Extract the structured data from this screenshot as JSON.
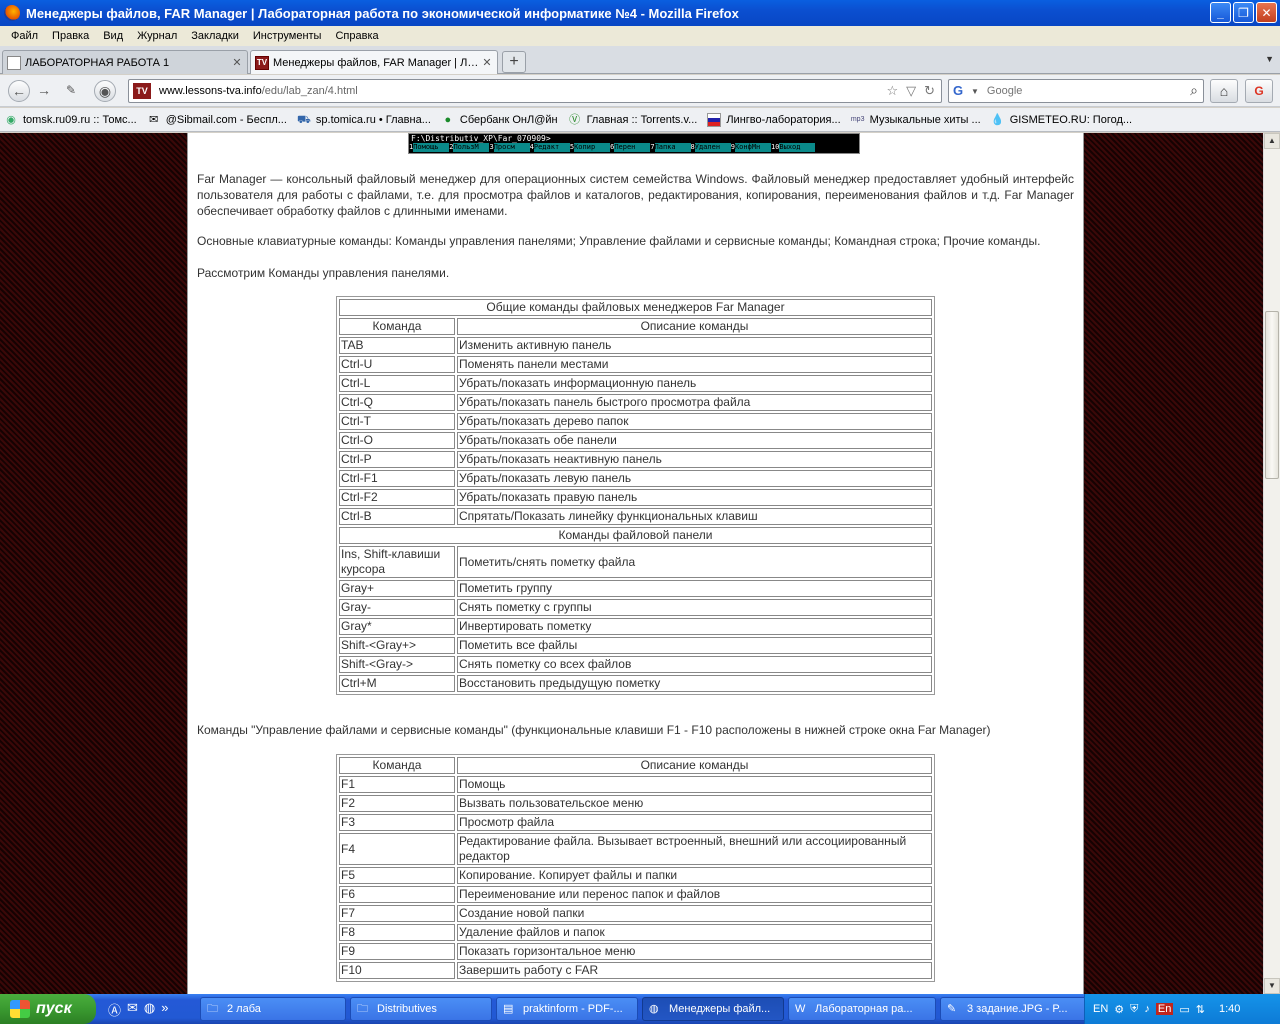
{
  "window": {
    "title": "Менеджеры файлов, FAR Manager | Лабораторная работа по экономической информатике №4 - Mozilla Firefox"
  },
  "menu": [
    "Файл",
    "Правка",
    "Вид",
    "Журнал",
    "Закладки",
    "Инструменты",
    "Справка"
  ],
  "tabs": [
    {
      "label": "ЛАБОРАТОРНАЯ РАБОТА 1"
    },
    {
      "label": "Менеджеры файлов, FAR Manager | Ла..."
    }
  ],
  "nav": {
    "url_host": "www.lessons-tva.info",
    "url_path": "/edu/lab_zan/4.html",
    "search_placeholder": "Google",
    "site_icon": "TV"
  },
  "bookmarks": [
    {
      "label": "tomsk.ru09.ru :: Томс...",
      "icon": "globe-icon"
    },
    {
      "label": "@Sibmail.com - Беспл...",
      "icon": "mail-icon"
    },
    {
      "label": "sp.tomica.ru • Главна...",
      "icon": "cart-icon"
    },
    {
      "label": "Сбербанк ОнЛ@йн",
      "icon": "sberbank-icon"
    },
    {
      "label": "Главная :: Torrents.v...",
      "icon": "torrent-icon"
    },
    {
      "label": "Лингво-лаборатория...",
      "icon": "flag-icon"
    },
    {
      "label": "Музыкальные хиты ...",
      "icon": "mp3-icon"
    },
    {
      "label": "GISMETEO.RU: Погод...",
      "icon": "drop-icon"
    }
  ],
  "farshot": {
    "path": "F:\\Distributiv_XP\\Far_070909>",
    "keys": [
      {
        "n": "1",
        "l": "Помощь"
      },
      {
        "n": "2",
        "l": "ПользМ"
      },
      {
        "n": "3",
        "l": "Просм"
      },
      {
        "n": "4",
        "l": "Редакт"
      },
      {
        "n": "5",
        "l": "Копир"
      },
      {
        "n": "6",
        "l": "Перен"
      },
      {
        "n": "7",
        "l": "Папка"
      },
      {
        "n": "8",
        "l": "Удален"
      },
      {
        "n": "9",
        "l": "КонфМн"
      },
      {
        "n": "10",
        "l": "Выход"
      }
    ]
  },
  "content": {
    "para1": "Far Manager — консольный файловый менеджер для операционных систем семейства Windows. Файловый менеджер предоставляет удобный интерфейс пользователя для работы с файлами, т.е. для просмотра файлов и каталогов, редактирования, копирования, переименования файлов и т.д. Far Manager обеспечивает обработку файлов с длинными именами.",
    "para2": "Основные клавиатурные команды: Команды управления панелями; Управление файлами и сервисные команды; Командная строка; Прочие команды.",
    "para3": "Рассмотрим Команды управления панелями.",
    "para4": "Команды \"Управление файлами и сервисные команды\" (функциональные клавиши F1 - F10 расположены в нижней строке окна Far Manager)"
  },
  "table1": {
    "caption": "Общие команды файловых менеджеров Far Manager",
    "col_key": "Команда",
    "col_desc": "Описание команды",
    "rows": [
      [
        "TAB",
        "Изменить активную панель"
      ],
      [
        "Ctrl-U",
        "Поменять панели местами"
      ],
      [
        "Ctrl-L",
        "Убрать/показать информационную панель"
      ],
      [
        "Ctrl-Q",
        "Убрать/показать панель быстрого просмотра файла"
      ],
      [
        "Ctrl-T",
        "Убрать/показать дерево папок"
      ],
      [
        "Ctrl-O",
        "Убрать/показать обе панели"
      ],
      [
        "Ctrl-P",
        "Убрать/показать неактивную панель"
      ],
      [
        "Ctrl-F1",
        "Убрать/показать левую панель"
      ],
      [
        "Ctrl-F2",
        "Убрать/показать правую панель"
      ],
      [
        "Ctrl-B",
        "Спрятать/Показать линейку функциональных клавиш"
      ]
    ],
    "section2": "Команды файловой панели",
    "rows2": [
      [
        "Ins, Shift-клавиши курсора",
        "Пометить/снять пометку файла"
      ],
      [
        "Gray+",
        "Пометить группу"
      ],
      [
        "Gray-",
        "Снять пометку с группы"
      ],
      [
        "Gray*",
        "Инвертировать пометку"
      ],
      [
        "Shift-<Gray+>",
        "Пометить все файлы"
      ],
      [
        "Shift-<Gray->",
        "Снять пометку со всех файлов"
      ],
      [
        "Ctrl+M",
        "Восстановить предыдущую пометку"
      ]
    ]
  },
  "table2": {
    "col_key": "Команда",
    "col_desc": "Описание команды",
    "rows": [
      [
        "F1",
        "Помощь"
      ],
      [
        "F2",
        "Вызвать пользовательское меню"
      ],
      [
        "F3",
        "Просмотр файла"
      ],
      [
        "F4",
        "Редактирование файла. Вызывает встроенный, внешний или ассоциированный редактор"
      ],
      [
        "F5",
        "Копирование. Копирует файлы и папки"
      ],
      [
        "F6",
        "Переименование или перенос папок и файлов"
      ],
      [
        "F7",
        "Создание новой папки"
      ],
      [
        "F8",
        "Удаление файлов и папок"
      ],
      [
        "F9",
        "Показать горизонтальное меню"
      ],
      [
        "F10",
        "Завершить работу с FAR"
      ]
    ]
  },
  "taskbar": {
    "start": "пуск",
    "tasks": [
      {
        "label": "2 лаба",
        "icon": "folder-icon"
      },
      {
        "label": "Distributives",
        "icon": "folder-icon"
      },
      {
        "label": "praktinform - PDF-...",
        "icon": "pdf-icon"
      },
      {
        "label": "Менеджеры файл...",
        "icon": "firefox-icon",
        "active": true
      },
      {
        "label": "Лабораторная ра...",
        "icon": "word-icon"
      },
      {
        "label": "3 задание.JPG - P...",
        "icon": "paint-icon"
      }
    ],
    "lang": "EN",
    "lang2": "En",
    "clock": "1:40"
  }
}
